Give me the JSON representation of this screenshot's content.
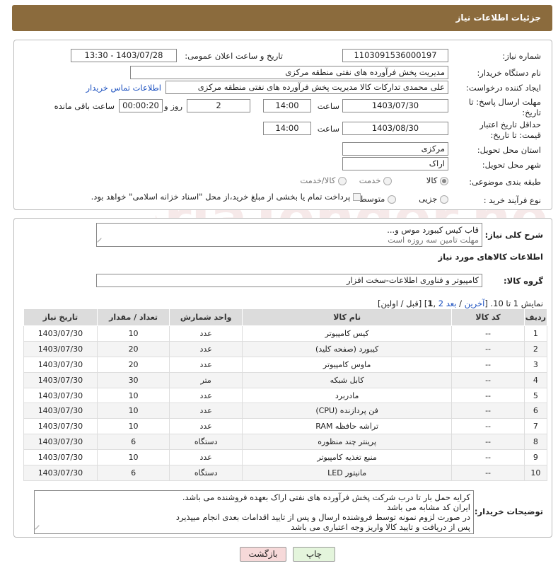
{
  "header": {
    "title": "جزئیات اطلاعات نیاز"
  },
  "info": {
    "need_number_label": "شماره نیاز:",
    "need_number": "1103091536000197",
    "announce_label": "تاریخ و ساعت اعلان عمومی:",
    "announce_value": "1403/07/28 - 13:30",
    "buyer_label": "نام دستگاه خریدار:",
    "buyer_value": "مدیریت پخش فرآورده های نفتی منطقه مرکزی",
    "creator_label": "ایجاد کننده درخواست:",
    "creator_value": "علی محمدی تدارکات کالا مدیریت پخش فرآورده های نفتی منطقه مرکزی",
    "contact_link": "اطلاعات تماس خریدار",
    "deadline_label": "مهلت ارسال پاسخ: تا تاریخ:",
    "deadline_date": "1403/07/30",
    "time_label": "ساعت",
    "deadline_time": "14:00",
    "days_value": "2",
    "days_label": "روز و",
    "remaining_value": "00:00:20",
    "remaining_label": "ساعت باقی مانده",
    "validity_label": "حداقل تاریخ اعتبار قیمت: تا تاریخ:",
    "validity_date": "1403/08/30",
    "validity_time": "14:00",
    "province_label": "استان محل تحویل:",
    "province_value": "مرکزی",
    "city_label": "شهر محل تحویل:",
    "city_value": "اراک",
    "category_label": "طبقه بندی موضوعی:",
    "category_options": [
      "کالا",
      "خدمت",
      "کالا/خدمت"
    ],
    "category_selected": "کالا",
    "process_label": "نوع فرآیند خرید :",
    "process_options": [
      "جزیی",
      "متوسط"
    ],
    "process_selected": "جزیی",
    "payment_text": "پرداخت تمام یا بخشی از مبلغ خرید،از محل \"اسناد خزانه اسلامی\" خواهد بود."
  },
  "summary": {
    "label": "شرح کلی نیاز:",
    "lines": [
      "قاب کیس کیبورد موس و...",
      "مهلت تامین سه روزه است"
    ]
  },
  "goods": {
    "section_title": "اطلاعات کالاهای مورد نیاز",
    "group_label": "گروه کالا:",
    "group_value": "کامپیوتر و فناوری اطلاعات-سخت افزار"
  },
  "pagination": {
    "prefix": "نمایش 1 تا 10. [",
    "last": "آخرین",
    "sep1": " / ",
    "next": "بعد",
    "page2": "2",
    "current": "1",
    "suffix": "[قبل / اولین]"
  },
  "table": {
    "headers": [
      "ردیف",
      "کد کالا",
      "نام کالا",
      "واحد شمارش",
      "تعداد / مقدار",
      "تاریخ نیاز"
    ],
    "rows": [
      [
        "1",
        "--",
        "کیس کامپیوتر",
        "عدد",
        "10",
        "1403/07/30"
      ],
      [
        "2",
        "--",
        "کیبورد (صفحه کلید)",
        "عدد",
        "20",
        "1403/07/30"
      ],
      [
        "3",
        "--",
        "ماوس کامپیوتر",
        "عدد",
        "20",
        "1403/07/30"
      ],
      [
        "4",
        "--",
        "کابل شبکه",
        "متر",
        "30",
        "1403/07/30"
      ],
      [
        "5",
        "--",
        "مادربرد",
        "عدد",
        "10",
        "1403/07/30"
      ],
      [
        "6",
        "--",
        "فن پردازنده (CPU)",
        "عدد",
        "10",
        "1403/07/30"
      ],
      [
        "7",
        "--",
        "تراشه حافظه RAM",
        "عدد",
        "10",
        "1403/07/30"
      ],
      [
        "8",
        "--",
        "پرینتر چند منظوره",
        "دستگاه",
        "6",
        "1403/07/30"
      ],
      [
        "9",
        "--",
        "منبع تغذیه کامپیوتر",
        "عدد",
        "10",
        "1403/07/30"
      ],
      [
        "10",
        "--",
        "مانیتور LED",
        "دستگاه",
        "6",
        "1403/07/30"
      ]
    ]
  },
  "notes": {
    "label": "توضیحات خریدار:",
    "lines": [
      "کرایه حمل بار تا درب شرکت  پخش فرآورده های نفتی اراک بعهده فروشنده می باشد.",
      "ایران کد مشابه می باشد",
      "در صورت لزوم نمونه توسط فروشنده ارسال و پس از تایید اقدامات بعدی انجام میپذیرد",
      "پس از دریافت و تایید کالا واریز وجه اعتباری می باشد"
    ]
  },
  "buttons": {
    "print": "چاپ",
    "back": "بازگشت"
  },
  "colors": {
    "header_bg": "#8b6b3d",
    "link": "#1a4fbf",
    "back_btn_bg": "#f6d9d9",
    "print_btn_bg": "#e4f5dc"
  }
}
